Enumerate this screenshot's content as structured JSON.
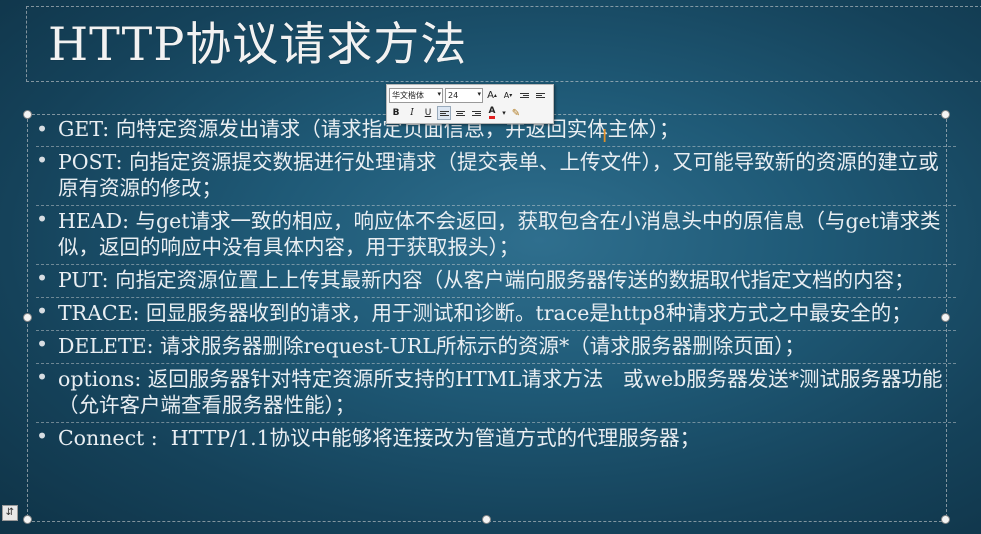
{
  "slide": {
    "title": "HTTP协议请求方法",
    "bullets": [
      "GET: 向特定资源发出请求（请求指定页面信息，并返回实体主体）；",
      "POST: 向指定资源提交数据进行处理请求（提交表单、上传文件），又可能导致新的资源的建立或原有资源的修改；",
      "HEAD: 与get请求一致的相应，响应体不会返回，获取包含在小消息头中的原信息（与get请求类似，返回的响应中没有具体内容，用于获取报头）；",
      "PUT: 向指定资源位置上上传其最新内容（从客户端向服务器传送的数据取代指定文档的内容；",
      "TRACE: 回显服务器收到的请求，用于测试和诊断。trace是http8种请求方式之中最安全的；",
      "DELETE: 请求服务器删除request-URL所标示的资源*（请求服务器删除页面）；",
      "options: 返回服务器针对特定资源所支持的HTML请求方法   或web服务器发送*测试服务器功能（允许客户端查看服务器性能）；",
      "Connect :  HTTP/1.1协议中能够将连接改为管道方式的代理服务器；"
    ],
    "bullet_glyph": "•"
  },
  "minibar": {
    "font_name": "华文楷体",
    "font_size": "24",
    "grow_label": "A",
    "shrink_label": "A",
    "bold": "B",
    "italic": "I",
    "underline": "U",
    "font_color_label": "A",
    "dropdown_glyph": "▾"
  },
  "cursor_glyph": "I",
  "corner_glyph": "⇵",
  "colors": {
    "background": "#1f5a77",
    "text": "#e9eef2",
    "font_color_swatch": "#e02020"
  }
}
